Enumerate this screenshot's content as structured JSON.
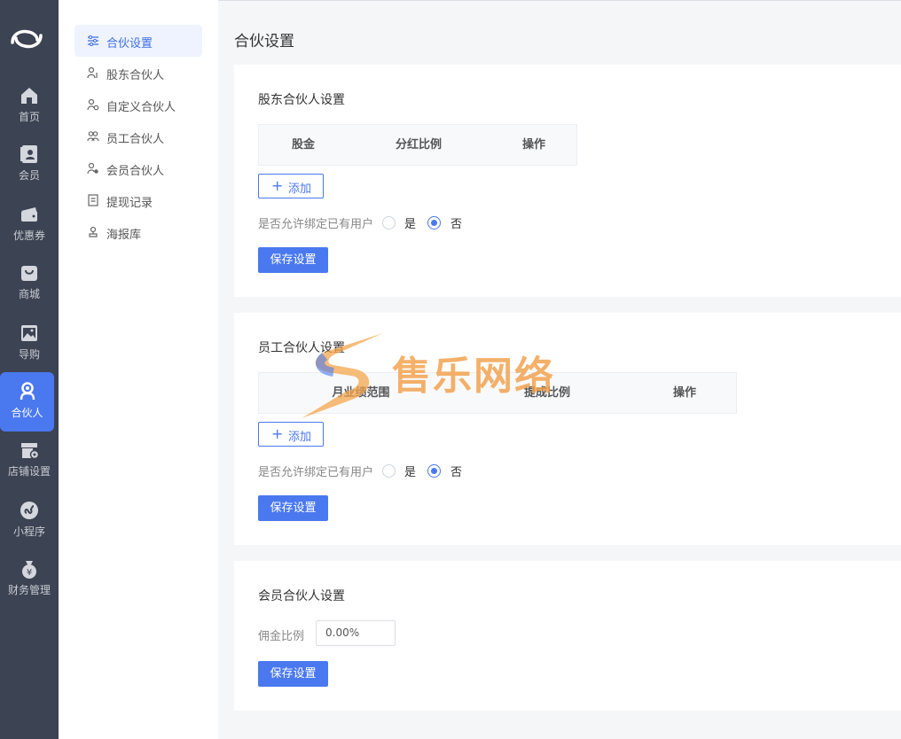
{
  "nav": {
    "items": [
      {
        "label": "首页",
        "icon": "home-icon"
      },
      {
        "label": "会员",
        "icon": "member-card-icon"
      },
      {
        "label": "优惠券",
        "icon": "coupon-icon"
      },
      {
        "label": "商城",
        "icon": "shop-bag-icon"
      },
      {
        "label": "导购",
        "icon": "image-icon"
      },
      {
        "label": "合伙人",
        "icon": "partner-icon"
      },
      {
        "label": "店铺设置",
        "icon": "store-settings-icon"
      },
      {
        "label": "小程序",
        "icon": "mini-program-icon"
      },
      {
        "label": "财务管理",
        "icon": "finance-icon"
      }
    ],
    "active": "合伙人",
    "accent": "#4a78ef"
  },
  "side": {
    "items": [
      {
        "label": "合伙设置",
        "icon": "sliders-icon"
      },
      {
        "label": "股东合伙人",
        "icon": "shareholder-icon"
      },
      {
        "label": "自定义合伙人",
        "icon": "custom-partner-icon"
      },
      {
        "label": "员工合伙人",
        "icon": "staff-icon"
      },
      {
        "label": "会员合伙人",
        "icon": "member-partner-icon"
      },
      {
        "label": "提现记录",
        "icon": "document-icon"
      },
      {
        "label": "海报库",
        "icon": "poster-icon"
      }
    ],
    "active": "合伙设置"
  },
  "main": {
    "title": "合伙设置",
    "shareholder": {
      "title": "股东合伙人设置",
      "columns": [
        "股金",
        "分红比例",
        "操作"
      ],
      "add_label": "添加",
      "bind_label": "是否允许绑定已有用户",
      "yes": "是",
      "no": "否",
      "selected": "否",
      "save_label": "保存设置"
    },
    "staff": {
      "title": "员工合伙人设置",
      "columns": [
        "月业绩范围",
        "提成比例",
        "操作"
      ],
      "add_label": "添加",
      "bind_label": "是否允许绑定已有用户",
      "yes": "是",
      "no": "否",
      "selected": "否",
      "save_label": "保存设置"
    },
    "member": {
      "title": "会员合伙人设置",
      "commission_label": "佣金比例",
      "commission_value": "0.00%",
      "save_label": "保存设置"
    }
  },
  "watermark": {
    "text": "售乐网络"
  }
}
